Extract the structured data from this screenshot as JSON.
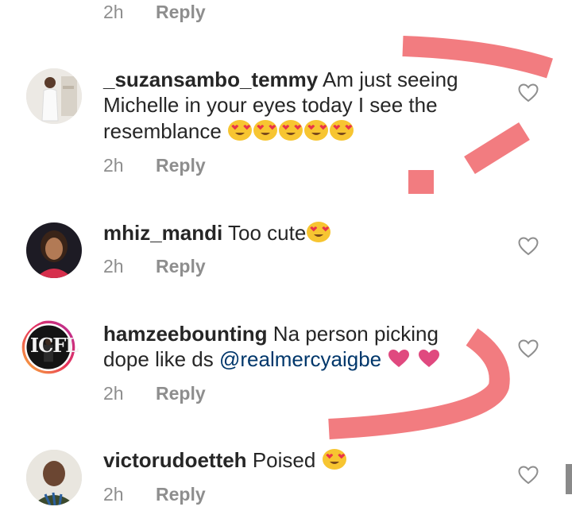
{
  "top_meta": {
    "time": "2h",
    "reply": "Reply"
  },
  "comments": [
    {
      "username": "_suzansambo_temmy",
      "text_line1": "Am just seeing",
      "text_line2": "Michelle in your eyes today I see the",
      "text_line3": "resemblance",
      "emoji": "heart-eyes-emoji",
      "emoji_count": 5,
      "time": "2h",
      "reply": "Reply"
    },
    {
      "username": "mhiz_mandi",
      "text": "Too cute",
      "emoji": "heart-eyes-emoji",
      "time": "2h",
      "reply": "Reply"
    },
    {
      "username": "hamzeebounting",
      "text_line1": "Na person picking",
      "text_line2": "dope like ds",
      "mention": "@realmercyaigbe",
      "emoji": "red-heart-emoji",
      "avatar_text": "ICFL",
      "time": "2h",
      "reply": "Reply"
    },
    {
      "username": "victorudoetteh",
      "text": "Poised",
      "emoji": "heart-eyes-emoji",
      "time": "2h",
      "reply": "Reply"
    }
  ],
  "colors": {
    "text": "#262626",
    "meta": "#8e8e8e",
    "mention": "#00376b",
    "annotation": "#f27c80"
  }
}
